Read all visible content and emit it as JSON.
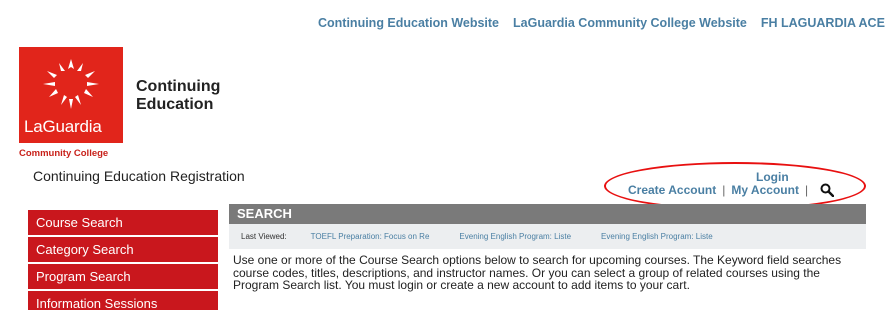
{
  "top_nav": {
    "links": [
      "Continuing Education Website",
      "LaGuardia Community College Website",
      "FH LAGUARDIA ACE"
    ]
  },
  "logo": {
    "wordmark": "LaGuardia",
    "subtitle": "Community College",
    "title_line1": "Continuing",
    "title_line2": "Education",
    "brand_color": "#e1251b"
  },
  "page": {
    "registration_title": "Continuing Education Registration"
  },
  "account": {
    "login": "Login",
    "create_account": "Create Account",
    "separator": "|",
    "my_account": "My Account",
    "search_icon": "search-icon"
  },
  "sidebar": {
    "items": [
      "Course Search",
      "Category Search",
      "Program Search",
      "Information Sessions"
    ],
    "color": "#c9171d"
  },
  "main": {
    "header": "SEARCH",
    "last_viewed_label": "Last Viewed:",
    "recently_viewed": [
      "TOEFL Preparation: Focus on Re",
      "Evening English Program: Liste",
      "Evening English Program: Liste"
    ],
    "description": "Use one or more of the Course Search options below to search for upcoming courses. The Keyword field searches course codes, titles, descriptions, and instructor names. Or you can select a group of related courses using the Program Search list. You must login or create a new account to add items to your cart."
  }
}
